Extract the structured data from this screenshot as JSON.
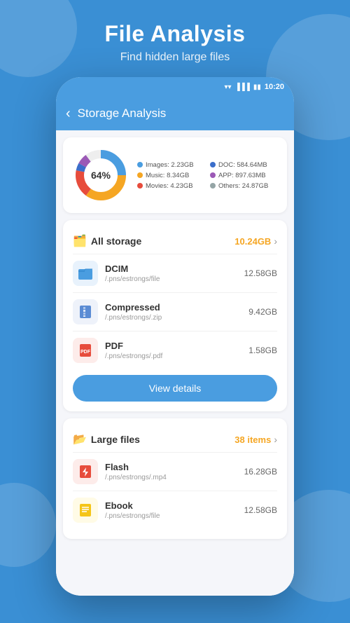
{
  "header": {
    "title": "File Analysis",
    "subtitle": "Find hidden large files"
  },
  "phone": {
    "status_bar": {
      "time": "10:20"
    },
    "top_bar": {
      "back_label": "<",
      "title": "Storage Analysis"
    },
    "storage_card": {
      "donut_percent": "64%",
      "legend": [
        {
          "label": "Images: 2.23GB",
          "color": "#4a9de0"
        },
        {
          "label": "DOC: 584.64MB",
          "color": "#3b6eca"
        },
        {
          "label": "Music: 8.34GB",
          "color": "#f5a623"
        },
        {
          "label": "APP: 897.63MB",
          "color": "#e74c3c"
        },
        {
          "label": "Movies: 4.23GB",
          "color": "#e74c3c"
        },
        {
          "label": "Others: 24.87GB",
          "color": "#95a5a6"
        }
      ]
    },
    "all_storage": {
      "section_title": "All storage",
      "section_value": "10.24GB",
      "items": [
        {
          "name": "DCIM",
          "path": "/.pns/estrongs/file",
          "size": "12.58GB",
          "icon_color": "#4a9de0",
          "icon": "📁"
        },
        {
          "name": "Compressed",
          "path": "/.pns/estrongs/.zip",
          "size": "9.42GB",
          "icon_color": "#5b8cd4",
          "icon": "🗜️"
        },
        {
          "name": "PDF",
          "path": "/.pns/estrongs/.pdf",
          "size": "1.58GB",
          "icon_color": "#e74c3c",
          "icon": "📄"
        }
      ],
      "button_label": "View details"
    },
    "large_files": {
      "section_title": "Large files",
      "section_value": "38 items",
      "items": [
        {
          "name": "Flash",
          "path": "/.pns/estrongs/.mp4",
          "size": "16.28GB",
          "icon_color": "#e74c3c",
          "icon": "⚡"
        },
        {
          "name": "Ebook",
          "path": "/.pns/estrongs/file",
          "size": "12.58GB",
          "icon_color": "#f5c518",
          "icon": "📒"
        }
      ]
    }
  }
}
